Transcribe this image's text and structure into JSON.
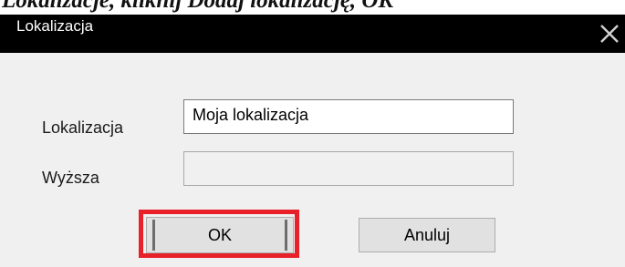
{
  "caption": {
    "text": "Lokalizacje, kliknij Dodaj lokalizację, OK"
  },
  "dialog": {
    "title": "Lokalizacja",
    "close_icon": "close-x-icon",
    "fields": [
      {
        "label": "Lokalizacja",
        "value": "Moja lokalizacja",
        "enabled": true
      },
      {
        "label": "Wyższa",
        "value": "",
        "enabled": false
      }
    ],
    "buttons": {
      "ok": "OK",
      "cancel": "Anuluj"
    }
  },
  "annotation": {
    "highlight_color": "#e8202a",
    "highlighted": "OK"
  }
}
